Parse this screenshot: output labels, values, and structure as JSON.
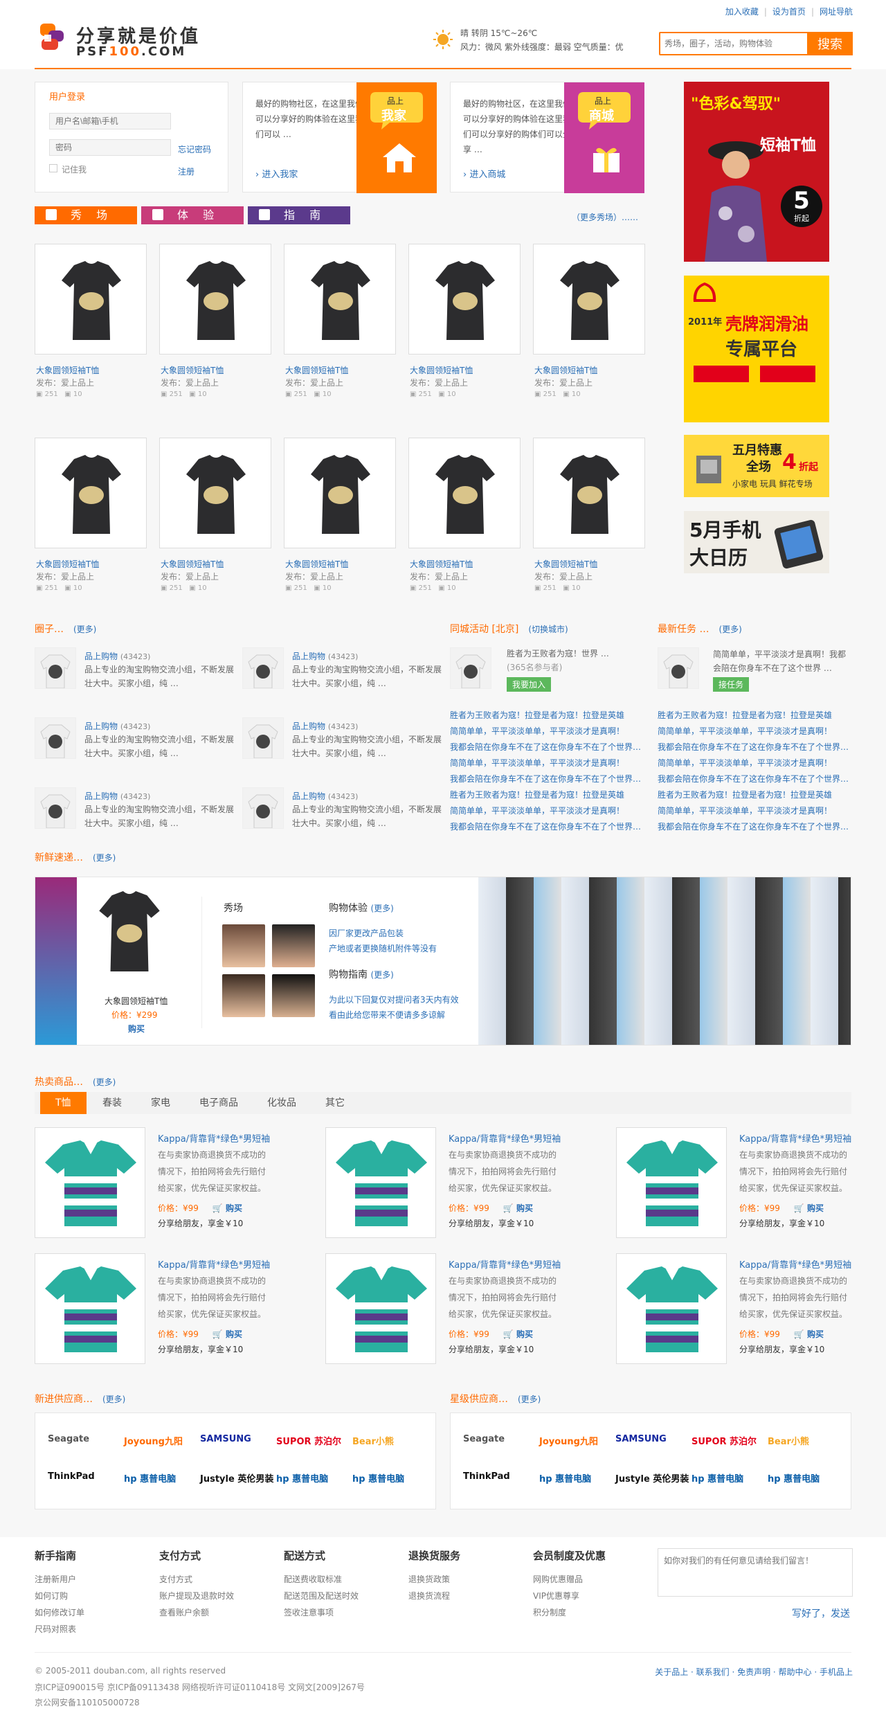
{
  "header": {
    "links": [
      "加入收藏",
      "设为首页",
      "网址导航"
    ],
    "logo_cn": "分享就是价值",
    "logo_en_a": "PSF",
    "logo_en_b": "100",
    "logo_en_c": ".COM",
    "weather_line1": "晴 转阴  15℃~26℃",
    "weather_line2": "风力：微风   紫外线强度：最弱   空气质量：优",
    "search_placeholder": "秀场，圈子，活动，购物体验",
    "search_button": "搜索"
  },
  "login": {
    "title": "用户登录",
    "user_placeholder": "用户名\\邮箱\\手机",
    "pass_placeholder": "密码",
    "forgot": "忘记密码",
    "remember": "记住我",
    "register": "注册"
  },
  "promo1": {
    "text": "最好的购物社区，在这里我们可以分享好的购体验在这里我们可以 …",
    "link": "进入我家",
    "badge_top": "品上",
    "badge_big": "我家"
  },
  "promo2": {
    "text": "最好的购物社区，在这里我们可以分享好的购体验在这里我们可以分享好的购体们可以分享 …",
    "link": "进入商城",
    "badge_top": "品上",
    "badge_big": "商城"
  },
  "tabs": [
    "秀 场",
    "体 验",
    "指 南"
  ],
  "tabs_more": "（更多秀场）……",
  "products": {
    "title": "大象圆领短袖T恤",
    "poster": "发布：爱上品上",
    "views": "251",
    "comments": "10"
  },
  "ads": {
    "ad1_a": "\"色彩&驾驭\"",
    "ad1_b": "短袖T恤",
    "ad1_c": "5",
    "ad1_d": "折起",
    "ad2_a": "2011年",
    "ad2_b": "壳牌润滑油",
    "ad2_c": "专属平台",
    "ad3_a": "五月特惠",
    "ad3_b": "全场",
    "ad3_c": "4",
    "ad3_d": "折起",
    "ad3_e": "小家电 玩具 鲜花专场",
    "ad4_a": "5月手机",
    "ad4_b": "大日历"
  },
  "circles": {
    "title": "圈子…",
    "more": "(更多)",
    "name": "品上购物",
    "count": "(43423)",
    "desc": "品上专业的淘宝购物交流小组，不断发展壮大中。买家小组，纯 …"
  },
  "city": {
    "title": "同城活动 [北京]",
    "switch": "(切换城市)",
    "desc": "胜者为王败者为寇！世界 …",
    "count": "(365名参与者)",
    "btn": "我要加入",
    "lines": [
      "胜者为王败者为寇！拉登是者为寇！拉登是英雄",
      "简简单单，平平淡淡单单，平平淡淡才是真啊！",
      "我都会陪在你身车不在了这在你身车不在了个世界…",
      "简简单单，平平淡淡单单，平平淡淡才是真啊！",
      "我都会陪在你身车不在了这在你身车不在了个世界…",
      "胜者为王败者为寇！拉登是者为寇！拉登是英雄",
      "简简单单，平平淡淡单单，平平淡淡才是真啊！",
      "我都会陪在你身车不在了这在你身车不在了个世界…"
    ]
  },
  "tasks": {
    "title": "最新任务 …",
    "more": "(更多)",
    "desc": "简简单单，平平淡淡才是真啊！我都会陪在你身车不在了这个世界 …",
    "btn": "接任务",
    "lines": [
      "胜者为王败者为寇！拉登是者为寇！拉登是英雄",
      "简简单单，平平淡淡单单，平平淡淡才是真啊！",
      "我都会陪在你身车不在了这在你身车不在了个世界…",
      "简简单单，平平淡淡单单，平平淡淡才是真啊！",
      "我都会陪在你身车不在了这在你身车不在了个世界…",
      "胜者为王败者为寇！拉登是者为寇！拉登是英雄",
      "简简单单，平平淡淡单单，平平淡淡才是真啊！",
      "我都会陪在你身车不在了这在你身车不在了个世界…"
    ]
  },
  "fresh": {
    "title": "新鲜速递…",
    "more": "(更多)",
    "prod_name": "大象圆领短袖T恤",
    "price_label": "价格：",
    "price": "¥299",
    "buy": "购买",
    "show": "秀场",
    "exp_title": "购物体验",
    "exp_more": "(更多)",
    "exp_1": "因厂家更改产品包装",
    "exp_2": "产地或者更换随机附件等没有",
    "guide_title": "购物指南",
    "guide_more": "(更多)",
    "guide_1": "为此以下回复仅对提问者3天内有效",
    "guide_2": "看由此给您带来不便请多多谅解"
  },
  "hot": {
    "title": "热卖商品…",
    "more": "(更多)",
    "tabs": [
      "T恤",
      "春装",
      "家电",
      "电子商品",
      "化妆品",
      "其它"
    ],
    "prod_title": "Kappa/背靠背*绿色*男短袖",
    "prod_desc": "在与卖家协商退换货不成功的情况下，拍拍网将会先行赔付给买家，优先保证买家权益。",
    "price": "价格：¥99",
    "buy": "购买",
    "share": "分享给朋友，享金￥10"
  },
  "suppliers": {
    "new_title": "新进供应商…",
    "star_title": "星级供应商…",
    "more": "(更多)",
    "row1": [
      "Seagate",
      "Joyoung九阳",
      "SAMSUNG",
      "SUPOR 苏泊尔",
      "Bear小熊"
    ],
    "row2": [
      "ThinkPad",
      "hp 惠普电脑",
      "Justyle 英伦男装",
      "hp 惠普电脑",
      "hp 惠普电脑"
    ]
  },
  "footer": {
    "cols": [
      {
        "title": "新手指南",
        "items": [
          "注册新用户",
          "如何订购",
          "如何修改订单",
          "尺码对照表"
        ]
      },
      {
        "title": "支付方式",
        "items": [
          "支付方式",
          "账户提现及退款时效",
          "查看账户余额"
        ]
      },
      {
        "title": "配送方式",
        "items": [
          "配送费收取标准",
          "配送范围及配送时效",
          "签收注意事项"
        ]
      },
      {
        "title": "退换货服务",
        "items": [
          "退换货政策",
          "退换货流程"
        ]
      },
      {
        "title": "会员制度及优惠",
        "items": [
          "网购优惠赠品",
          "VIP优惠尊享",
          "积分制度"
        ]
      }
    ],
    "feedback_placeholder": "如你对我们的有任何意见请给我们留言！",
    "feedback_btn": "写好了，发送",
    "copyright": "© 2005-2011 douban.com, all rights reserved",
    "icp": "京ICP证090015号  京ICP备09113438  网络视听许可证0110418号  文网文[2009]267号",
    "police": "京公网安备110105000728",
    "bottom_links": "关于品上 · 联系我们 · 免责声明 · 帮助中心 · 手机品上"
  },
  "colors": {
    "accent": "#ff7a00",
    "link": "#2b6fb6",
    "tab1": "#ff6a00",
    "tab2": "#c83c7a",
    "tab3": "#5b3a8c"
  }
}
